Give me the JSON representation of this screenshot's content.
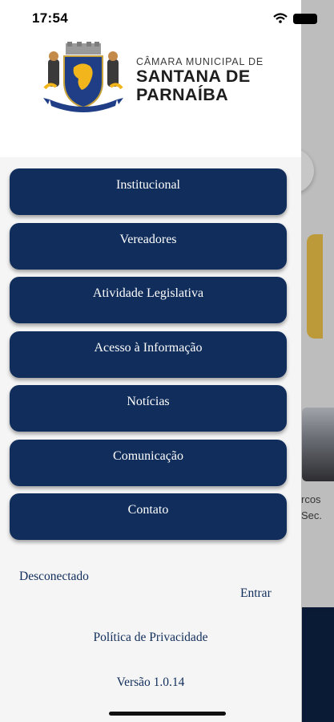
{
  "status_bar": {
    "time": "17:54"
  },
  "header": {
    "org_subtitle": "CÂMARA MUNICIPAL DE",
    "org_title_line1": "SANTANA DE",
    "org_title_line2": "PARNAÍBA",
    "logo_icon": "municipal-coat-of-arms"
  },
  "menu": {
    "items": [
      {
        "label": "Institucional"
      },
      {
        "label": "Vereadores"
      },
      {
        "label": "Atividade Legislativa"
      },
      {
        "label": "Acesso à Informação"
      },
      {
        "label": "Notícias"
      },
      {
        "label": "Comunicação"
      },
      {
        "label": "Contato"
      }
    ]
  },
  "footer": {
    "connection_status": "Desconectado",
    "login_label": "Entrar",
    "privacy_label": "Política de Privacidade",
    "version_label": "Versão 1.0.14"
  },
  "background_app": {
    "partial_text": "rcos\nSec."
  },
  "colors": {
    "primary": "#102d5b",
    "drawer_body": "#f5f5f5",
    "accent_card": "#f1c64b"
  }
}
